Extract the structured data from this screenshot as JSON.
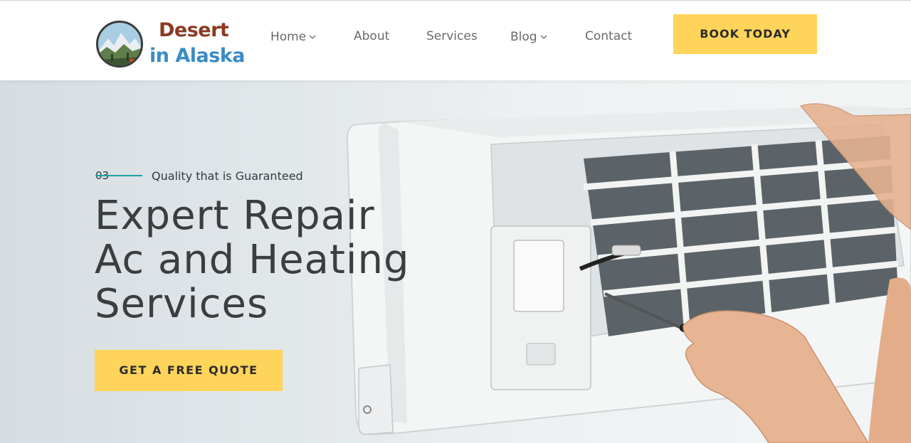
{
  "header": {
    "logo": {
      "line1": "Desert",
      "line2": "in Alaska"
    },
    "nav": [
      {
        "label": "Home",
        "has_dropdown": true
      },
      {
        "label": "About",
        "has_dropdown": false
      },
      {
        "label": "Services",
        "has_dropdown": false
      },
      {
        "label": "Blog",
        "has_dropdown": true
      },
      {
        "label": "Contact",
        "has_dropdown": false
      }
    ],
    "cta_label": "BOOK TODAY"
  },
  "hero": {
    "eyebrow_number": "03",
    "eyebrow_text": "Quality that is Guaranteed",
    "title_lines": [
      "Expert Repair",
      "Ac and Heating",
      "Services"
    ],
    "cta_label": "GET A FREE QUOTE"
  },
  "colors": {
    "accent_yellow": "#ffd45a",
    "teal_line": "#1aa3a6",
    "logo_brown": "#8a3a22",
    "logo_blue": "#3a8cc4",
    "title_text": "#3b3d40"
  }
}
